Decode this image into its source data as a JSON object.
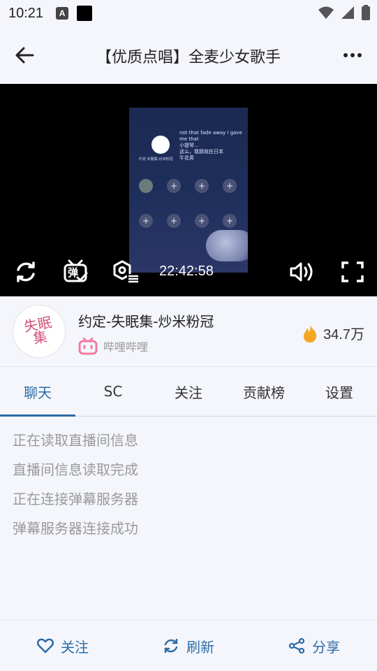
{
  "status_bar": {
    "time": "10:21",
    "notification_a": "A"
  },
  "app_bar": {
    "title": "【优质点唱】全麦少女歌手"
  },
  "video": {
    "time": "22:42:58",
    "danmaku_label": "弹",
    "stream_overlay": {
      "line1": "not that fade away i gave me that",
      "line2": "小提琴...",
      "line3": "这么，我那就在日本",
      "line4": "牛花男",
      "host_sub": "约定-失眠集-炒米粉冠"
    }
  },
  "streamer": {
    "avatar_text": "失眠集",
    "name": "约定-失眠集-炒米粉冠",
    "platform": "哔哩哔哩",
    "popularity": "34.7万"
  },
  "tabs": [
    {
      "label": "聊天",
      "active": true
    },
    {
      "label": "SC",
      "active": false
    },
    {
      "label": "关注",
      "active": false
    },
    {
      "label": "贡献榜",
      "active": false
    },
    {
      "label": "设置",
      "active": false
    }
  ],
  "messages": [
    "正在读取直播间信息",
    "直播间信息读取完成",
    "正在连接弹幕服务器",
    "弹幕服务器连接成功"
  ],
  "bottom_bar": {
    "follow": "关注",
    "refresh": "刷新",
    "share": "分享"
  },
  "colors": {
    "accent": "#2d6ba6",
    "background": "#f4f6fb",
    "bilibili_pink": "#f07aa0",
    "flame": "#f5a623"
  }
}
